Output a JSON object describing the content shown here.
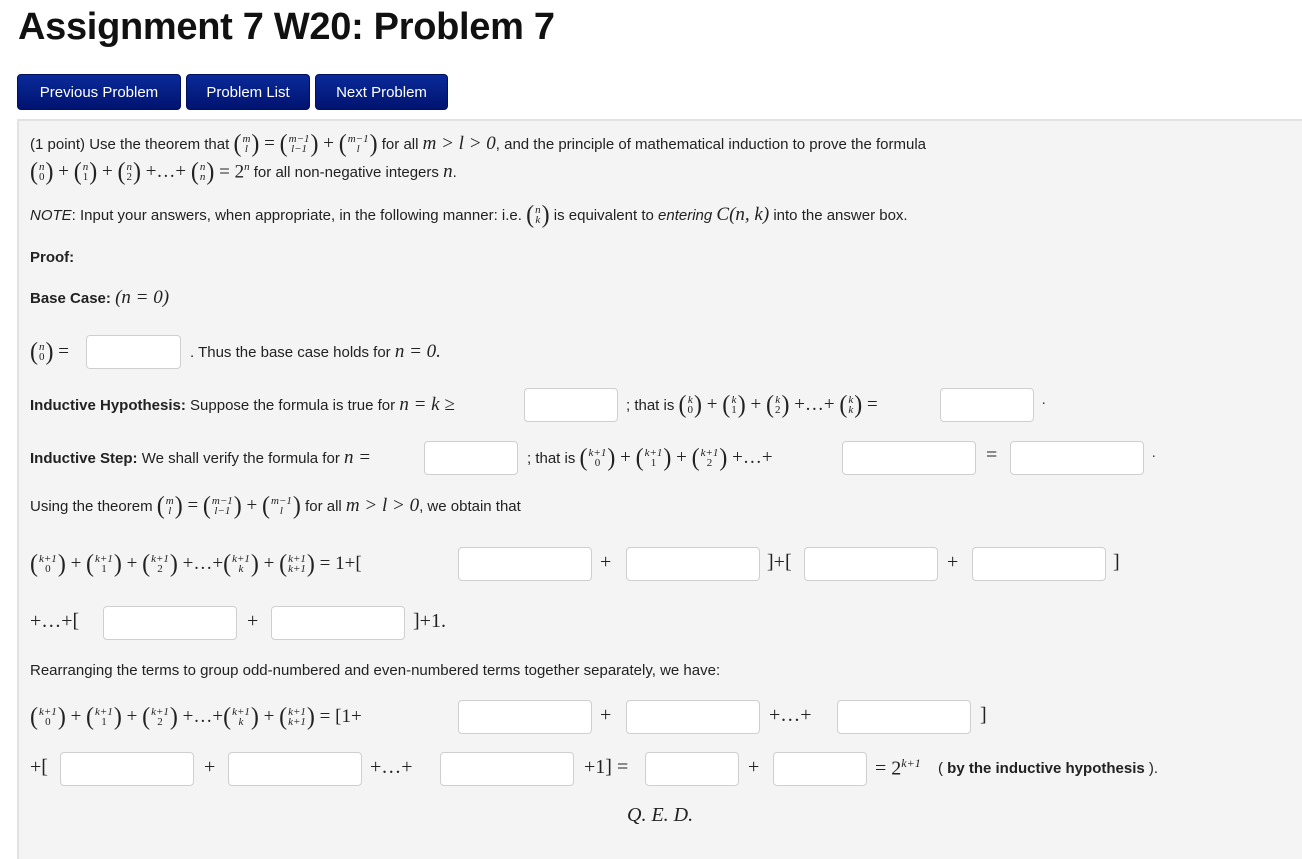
{
  "page": {
    "title": "Assignment 7 W20: Problem 7"
  },
  "nav": {
    "previous": "Previous Problem",
    "list": "Problem List",
    "next": "Next Problem"
  },
  "colors": {
    "button_bg": "#00168a",
    "panel_bg": "#f4f4f4"
  },
  "problem": {
    "intro_points": "(1 point) Use the theorem that",
    "intro_theorem": "(m l) = (m−1 l−1) + (m−1 l)",
    "intro_for_all": "for all",
    "intro_condition": "m > l > 0",
    "intro_rest": ", and the principle of mathematical induction to prove the formula",
    "formula": "(n 0) + (n 1) + (n 2) +…+ (n n) = 2^n",
    "formula_rest": "for all non-negative integers",
    "formula_var": "n",
    "note_label": "NOTE",
    "note_text": ": Input your answers, when appropriate, in the following manner: i.e.",
    "note_binom": "(n k)",
    "note_mid": "is equivalent to",
    "note_entering": "entering",
    "note_cnk": "C(n, k)",
    "note_end": "into the answer box.",
    "proof_label": "Proof:",
    "base_label": "Base Case:",
    "base_cond": "(n = 0)",
    "base_text": ". Thus the base case holds for",
    "base_end": "n = 0.",
    "ih_label": "Inductive Hypothesis:",
    "ih_text": "Suppose the formula is true for",
    "ih_cond": "n = k ≥",
    "ih_thatis": "; that is",
    "is_label": "Inductive Step:",
    "is_text": "We shall verify the formula for",
    "is_cond": "n =",
    "is_thatis": "; that is",
    "using_text": "Using the theorem",
    "using_forall": "for all",
    "using_cond": "m > l > 0",
    "using_end": ", we obtain that",
    "rearrange_text": "Rearranging the terms to group odd-numbered and even-numbered terms together separately, we have:",
    "by_ih": "by the inductive hypothesis",
    "qed": "Q. E. D."
  },
  "answers": {
    "base_value": "",
    "ih_k_min": "",
    "ih_sum": "",
    "is_n": "",
    "is_last_term": "",
    "is_sum": "",
    "expand_1a": "",
    "expand_1b": "",
    "expand_2a": "",
    "expand_2b": "",
    "expand_3a": "",
    "expand_3b": "",
    "rearr_1": "",
    "rearr_2": "",
    "rearr_3": "",
    "rearr_4": "",
    "rearr_5": "",
    "rearr_6": "",
    "final_a": "",
    "final_b": ""
  }
}
